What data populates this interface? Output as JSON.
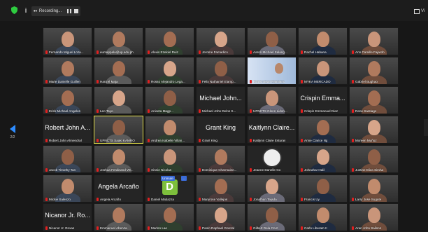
{
  "toolbar": {
    "info_label": "i",
    "recording_label": "Recording...",
    "view_label": "Vi"
  },
  "nav": {
    "page_left": "2/2"
  },
  "participants": [
    {
      "name": "Fernando Miguel Loza...",
      "kind": "photo"
    },
    {
      "name": "eumappala@up.edu.ph",
      "kind": "photo"
    },
    {
      "name": "Alexis Ezekiel Ruiz",
      "kind": "photo"
    },
    {
      "name": "Jerome Famadico",
      "kind": "photo"
    },
    {
      "name": "Aaron Michael Salang...",
      "kind": "photo"
    },
    {
      "name": "Rachel Habana",
      "kind": "photo"
    },
    {
      "name": "Ann Camille Fajardo",
      "kind": "photo"
    },
    {
      "name": "Marie Danielle Guillen",
      "kind": "photo"
    },
    {
      "name": "Hanzel Maja",
      "kind": "photo"
    },
    {
      "name": "Rosso Alejandro Lega...",
      "kind": "photo"
    },
    {
      "name": "Felix Nathaniel Elamp...",
      "kind": "photo"
    },
    {
      "name": "Hilario Sean Palmiano",
      "kind": "poster"
    },
    {
      "name": "MYKA MERCADO",
      "kind": "photo"
    },
    {
      "name": "Gabriel Bughao",
      "kind": "photo"
    },
    {
      "name": "Erick Michael Angeles",
      "kind": "photo"
    },
    {
      "name": "Leo Tayo",
      "kind": "photo"
    },
    {
      "name": "Aniceta Magp...",
      "kind": "photo"
    },
    {
      "name": "Michael John Delos S...",
      "kind": "text",
      "big": "Michael John..."
    },
    {
      "name": "UPNCTS Glenn Lidon...",
      "kind": "photo"
    },
    {
      "name": "Crispin Emmanuel Diaz",
      "kind": "text",
      "big": "Crispin Emma..."
    },
    {
      "name": "Rene Santiago",
      "kind": "photo"
    },
    {
      "name": "Robert John Almendral",
      "kind": "text",
      "big": "Robert John A..."
    },
    {
      "name": "UPNCTS Saaki KAMRO",
      "kind": "photo",
      "active": true
    },
    {
      "name": "Andrea Isabelle Villan...",
      "kind": "photo"
    },
    {
      "name": "Grant King",
      "kind": "text",
      "big": "Grant King"
    },
    {
      "name": "Kaitlynn Claire Esturas",
      "kind": "text",
      "big": "Kaitlynn Claire..."
    },
    {
      "name": "Anne Clarice Ng",
      "kind": "photo"
    },
    {
      "name": "Moreen Muñoz",
      "kind": "photo"
    },
    {
      "name": "Jacob Timothy Tan",
      "kind": "photo"
    },
    {
      "name": "Joshua Ferdinand V8...",
      "kind": "photo"
    },
    {
      "name": "Xinnie Nicolas",
      "kind": "photo"
    },
    {
      "name": "Dominique Charmaine...",
      "kind": "photo"
    },
    {
      "name": "Jeanne Danelle Go",
      "kind": "logo"
    },
    {
      "name": "Johnahar Halil",
      "kind": "photo"
    },
    {
      "name": "Justine Eliza Simha",
      "kind": "photo"
    },
    {
      "name": "Mickie Salenzo",
      "kind": "photo"
    },
    {
      "name": "Angela Arcaño",
      "kind": "text",
      "big": "Angela Arcaño"
    },
    {
      "name": "Daniel Mabazza",
      "kind": "letter",
      "letter": "D",
      "unmute": "Unmute",
      "more": "..."
    },
    {
      "name": "Maryrose Vallejos",
      "kind": "photo"
    },
    {
      "name": "Jonathan Tejada",
      "kind": "photo"
    },
    {
      "name": "Francis Uy",
      "kind": "photo"
    },
    {
      "name": "Larry Jose Sugate",
      "kind": "photo"
    },
    {
      "name": "Nicanor Jr. Roxas",
      "kind": "text",
      "big": "Nicanor Jr. Ro..."
    },
    {
      "name": "Emmanuel Abenza",
      "kind": "photo"
    },
    {
      "name": "Marlon Lao",
      "kind": "photo"
    },
    {
      "name": "Paolo Raphael Gonzal",
      "kind": "photo"
    },
    {
      "name": "Gilbert Dela Cruz",
      "kind": "photo"
    },
    {
      "name": "Carlo Liberato II",
      "kind": "photo"
    },
    {
      "name": "Aran John Salison",
      "kind": "photo"
    }
  ]
}
